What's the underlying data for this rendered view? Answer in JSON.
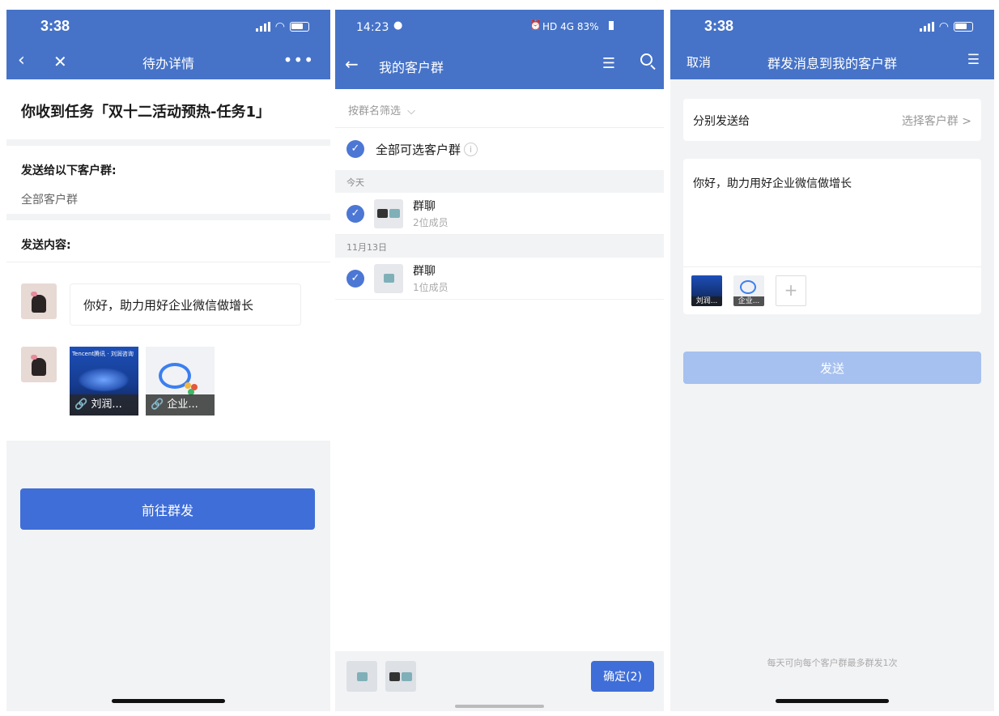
{
  "p1": {
    "time": "3:38",
    "nav_title": "待办详情",
    "back_icon": "chevron-left-icon",
    "close_icon": "close-icon",
    "more_icon": "more-icon",
    "task_title": "你收到任务「双十二活动预热-任务1」",
    "send_to_label": "发送给以下客户群:",
    "send_to_value": "全部客户群",
    "content_label": "发送内容:",
    "message": "你好，助力用好企业微信做增长",
    "attachments": [
      {
        "caption": "刘润...",
        "brand": "Tencent腾讯 · 刘润咨询"
      },
      {
        "caption": "企业..."
      }
    ],
    "go_button": "前往群发"
  },
  "p2": {
    "time": "14:23",
    "status_right": "HD 4G 83%",
    "nav_title": "我的客户群",
    "filter": "按群名筛选",
    "select_all": "全部可选客户群",
    "sections": [
      {
        "date": "今天",
        "name": "群聊",
        "members": "2位成员"
      },
      {
        "date": "11月13日",
        "name": "群聊",
        "members": "1位成员"
      }
    ],
    "confirm": "确定(2)"
  },
  "p3": {
    "time": "3:38",
    "cancel": "取消",
    "nav_title": "群发消息到我的客户群",
    "send_to_label": "分别发送给",
    "choose_group": "选择客户群 >",
    "message": "你好，助力用好企业微信做增长",
    "attach_captions": [
      "刘润...",
      "企业..."
    ],
    "add": "+",
    "send_button": "发送",
    "footer_note": "每天可向每个客户群最多群发1次"
  },
  "colors": {
    "brand_blue": "#4673c8",
    "button_blue": "#3f6ed8",
    "disabled_blue": "#a6c1ef"
  }
}
